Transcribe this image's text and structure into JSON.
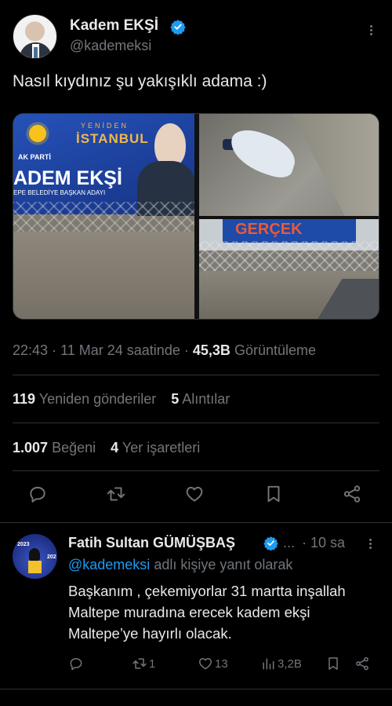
{
  "post": {
    "author_name": "Kadem EKŞİ",
    "handle": "@kademeksi",
    "text": "Nasıl kıydınız şu yakışıklı adama :)",
    "media": {
      "banner_logo_text": "AK PARTİ",
      "banner_city_prefix": "YENİDEN",
      "banner_city": "İSTANBUL",
      "banner_name": "ADEM EKŞİ",
      "banner_subtitle": "EPE BELEDİYE BAŞKAN ADAYI",
      "banner2_text": "GERÇEK"
    },
    "time": "22:43",
    "date": "11 Mar 24 saatinde",
    "views_count": "45,3B",
    "views_label": "Görüntüleme",
    "reposts_count": "119",
    "reposts_label": "Yeniden gönderiler",
    "quotes_count": "5",
    "quotes_label": "Alıntılar",
    "likes_count": "1.007",
    "likes_label": "Beğeni",
    "bookmarks_count": "4",
    "bookmarks_label": "Yer işaretleri",
    "dot": "·"
  },
  "reply": {
    "author_name": "Fatih Sultan GÜMÜŞBAŞ",
    "ellipsis": "...",
    "time": "· 10 sa",
    "mention": "@kademeksi",
    "replying_suffix": "adlı kişiye yanıt olarak",
    "avatar_text_left": "2023",
    "avatar_text_right": "202",
    "body": "Başkanım , çekemiyorlar 31 martta inşallah Maltepe muradına erecek kadem ekşi Maltepe’ye hayırlı olacak.",
    "reposts": "1",
    "likes": "13",
    "views": "3,2B"
  },
  "colors": {
    "background": "#000000",
    "text_primary": "#e7e9ea",
    "text_secondary": "#71767b",
    "link": "#1d9bf0",
    "divider": "#2f3336",
    "verified": "#1d9bf0"
  }
}
